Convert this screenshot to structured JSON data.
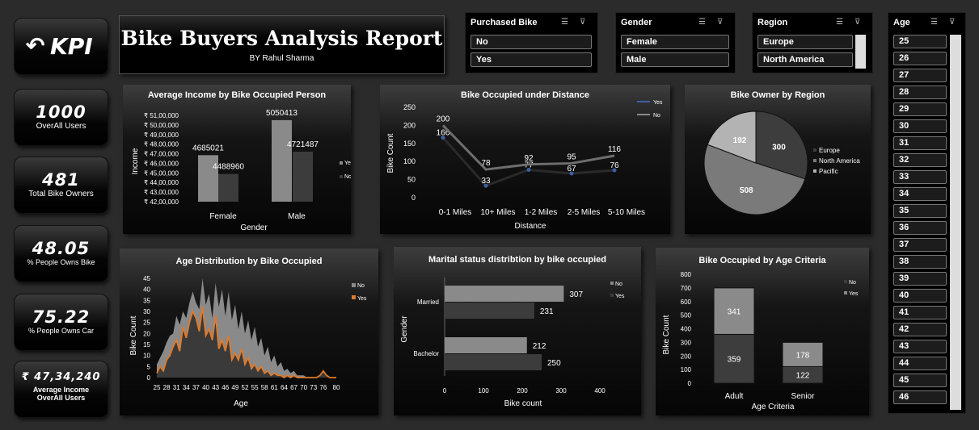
{
  "kpi_logo": {
    "arrow": "↶",
    "label": "KPI"
  },
  "header": {
    "title": "Bike Buyers Analysis Report",
    "subtitle": "BY Rahul Sharma"
  },
  "kpis": [
    {
      "value": "1000",
      "label": "OverAll Users"
    },
    {
      "value": "481",
      "label": "Total Bike Owners"
    },
    {
      "value": "48.05",
      "label": "% People Owns Bike"
    },
    {
      "value": "75.22",
      "label": "% People Owns Car"
    },
    {
      "value": "₹ 47,34,240",
      "label": "Average Income OverAll Users"
    }
  ],
  "slicers": {
    "purchased": {
      "title": "Purchased Bike",
      "items": [
        "No",
        "Yes"
      ]
    },
    "gender": {
      "title": "Gender",
      "items": [
        "Female",
        "Male"
      ]
    },
    "region": {
      "title": "Region",
      "items": [
        "Europe",
        "North America"
      ]
    },
    "age": {
      "title": "Age",
      "items": [
        "25",
        "26",
        "27",
        "28",
        "29",
        "30",
        "31",
        "32",
        "33",
        "34",
        "35",
        "36",
        "37",
        "38",
        "39",
        "40",
        "41",
        "42",
        "43",
        "44",
        "45",
        "46"
      ]
    }
  },
  "icons": {
    "multiselect": "multi-select-icon",
    "clear": "clear-filter-icon"
  },
  "chart_data": [
    {
      "type": "bar",
      "title": "Average Income by Bike Occupied Person",
      "xlabel": "Gender",
      "ylabel": "Income",
      "categories": [
        "Female",
        "Male"
      ],
      "series": [
        {
          "name": "Yes",
          "values": [
            4685021,
            5050413
          ]
        },
        {
          "name": "No",
          "values": [
            4488960,
            4721487
          ]
        }
      ],
      "ylim": [
        4200000,
        5100000
      ],
      "yticks": [
        "₹ 51,00,000",
        "₹ 50,00,000",
        "₹ 49,00,000",
        "₹ 48,00,000",
        "₹ 47,00,000",
        "₹ 46,00,000",
        "₹ 45,00,000",
        "₹ 44,00,000",
        "₹ 43,00,000",
        "₹ 42,00,000"
      ],
      "legend": "right"
    },
    {
      "type": "line",
      "title": "Bike Occupied under Distance",
      "xlabel": "Distance",
      "ylabel": "Bike Count",
      "categories": [
        "0-1 Miles",
        "10+ Miles",
        "1-2 Miles",
        "2-5 Miles",
        "5-10 Miles"
      ],
      "series": [
        {
          "name": "Yes",
          "values": [
            166,
            33,
            77,
            67,
            76
          ]
        },
        {
          "name": "No",
          "values": [
            200,
            78,
            92,
            95,
            116
          ]
        }
      ],
      "ylim": [
        0,
        250
      ],
      "yticks": [
        "250",
        "200",
        "150",
        "100",
        "50",
        "0"
      ],
      "legend": "top-right"
    },
    {
      "type": "pie",
      "title": "Bike Owner by Region",
      "categories": [
        "Europe",
        "North America",
        "Pacific"
      ],
      "values": [
        300,
        508,
        192
      ],
      "legend": "right"
    },
    {
      "type": "area",
      "title": "Age Distribution by Bike Occupied",
      "xlabel": "Age",
      "ylabel": "Bike Count",
      "xticks": [
        "25",
        "28",
        "31",
        "34",
        "37",
        "40",
        "43",
        "46",
        "49",
        "52",
        "55",
        "58",
        "61",
        "64",
        "67",
        "70",
        "73",
        "76",
        "80"
      ],
      "yticks": [
        "45",
        "40",
        "35",
        "30",
        "25",
        "20",
        "15",
        "10",
        "5",
        "0"
      ],
      "ylim": [
        0,
        45
      ],
      "x": [
        25,
        26,
        27,
        28,
        29,
        30,
        31,
        32,
        33,
        34,
        35,
        36,
        37,
        38,
        39,
        40,
        41,
        42,
        43,
        44,
        45,
        46,
        47,
        48,
        49,
        50,
        51,
        52,
        53,
        54,
        55,
        56,
        57,
        58,
        59,
        60,
        61,
        62,
        63,
        64,
        65,
        66,
        67,
        68,
        69,
        70,
        71,
        72,
        73,
        74,
        75,
        76,
        77,
        78,
        79,
        80
      ],
      "series": [
        {
          "name": "No",
          "values": [
            6,
            9,
            12,
            16,
            19,
            20,
            28,
            24,
            30,
            27,
            34,
            39,
            34,
            31,
            45,
            33,
            38,
            27,
            43,
            32,
            40,
            28,
            39,
            26,
            33,
            22,
            30,
            20,
            26,
            17,
            23,
            14,
            18,
            10,
            14,
            7,
            10,
            5,
            7,
            3,
            4,
            2,
            3,
            1,
            1,
            1,
            0,
            0,
            0,
            0,
            1,
            2,
            1,
            0,
            0,
            0
          ]
        },
        {
          "name": "Yes",
          "values": [
            2,
            5,
            3,
            8,
            10,
            14,
            17,
            12,
            23,
            18,
            25,
            30,
            27,
            21,
            32,
            19,
            22,
            17,
            28,
            13,
            17,
            12,
            19,
            8,
            11,
            8,
            13,
            6,
            9,
            4,
            6,
            3,
            5,
            2,
            3,
            1,
            2,
            1,
            1,
            0,
            1,
            0,
            1,
            0,
            0,
            0,
            0,
            0,
            0,
            0,
            1,
            3,
            1,
            0,
            0,
            0
          ]
        }
      ],
      "legend": "right"
    },
    {
      "type": "bar",
      "title": "Marital status distribtion by bike occupied",
      "xlabel": "Bike count",
      "ylabel": "Gender",
      "orientation": "horizontal",
      "categories": [
        "Married",
        "Bachelor"
      ],
      "series": [
        {
          "name": "No",
          "values": [
            307,
            212
          ]
        },
        {
          "name": "Yes",
          "values": [
            231,
            250
          ]
        }
      ],
      "xlim": [
        0,
        400
      ],
      "xticks": [
        "0",
        "100",
        "200",
        "300",
        "400"
      ],
      "legend": "right"
    },
    {
      "type": "bar",
      "title": "Bike Occupied by Age Criteria",
      "xlabel": "Age Criteria",
      "ylabel": "Bike Count",
      "stacked": true,
      "categories": [
        "Adult",
        "Senior"
      ],
      "series": [
        {
          "name": "No",
          "values": [
            341,
            178
          ]
        },
        {
          "name": "Yes",
          "values": [
            359,
            122
          ]
        }
      ],
      "ylim": [
        0,
        800
      ],
      "yticks": [
        "800",
        "700",
        "600",
        "500",
        "400",
        "300",
        "200",
        "100",
        "0"
      ],
      "legend": "right"
    }
  ]
}
